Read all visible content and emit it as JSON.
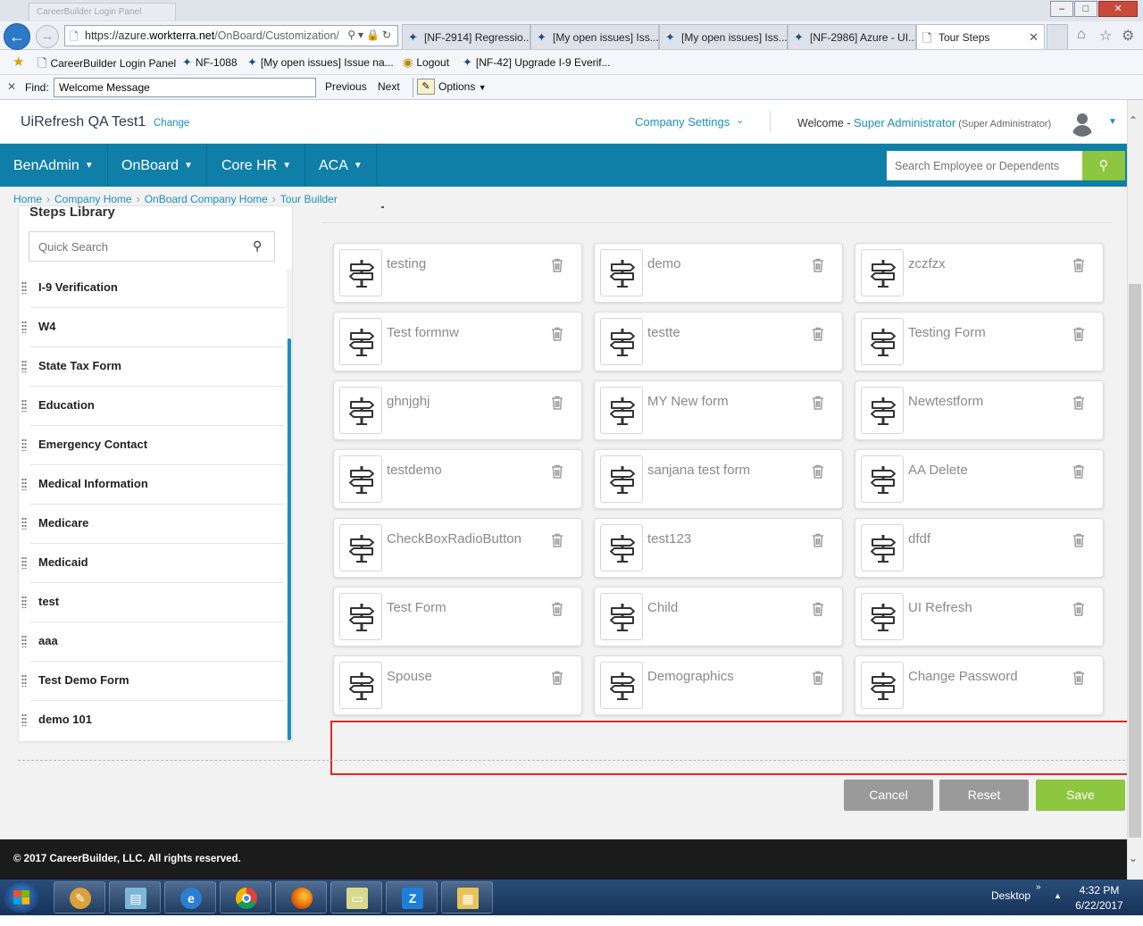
{
  "browser": {
    "ghost_tab": "CareerBuilder Login Panel",
    "url_prefix": "https://azure.",
    "url_domain": "workterra.net",
    "url_path": "/OnBoard/Customization/",
    "tabs": [
      {
        "label": "[NF-2914] Regressio..."
      },
      {
        "label": "[My open issues] Iss..."
      },
      {
        "label": "[My open issues] Iss..."
      },
      {
        "label": "[NF-2986] Azure - UI..."
      },
      {
        "label": "Tour Steps"
      }
    ],
    "favorites": [
      {
        "label": "CareerBuilder Login Panel"
      },
      {
        "label": "NF-1088"
      },
      {
        "label": "[My open issues] Issue na..."
      },
      {
        "label": "Logout"
      },
      {
        "label": "[NF-42] Upgrade I-9 Everif..."
      }
    ],
    "find": {
      "label": "Find:",
      "value": "Welcome Message",
      "previous": "Previous",
      "next": "Next",
      "options": "Options"
    }
  },
  "header": {
    "company": "UiRefresh QA Test1",
    "change": "Change",
    "company_settings": "Company Settings",
    "welcome_prefix": "Welcome - ",
    "user_name": "Super Administrator",
    "user_role": " (Super Administrator)"
  },
  "nav": {
    "menus": [
      {
        "label": "BenAdmin"
      },
      {
        "label": "OnBoard"
      },
      {
        "label": "Core HR"
      },
      {
        "label": "ACA"
      }
    ],
    "search_placeholder": "Search Employee or Dependents"
  },
  "breadcrumb": [
    "Home",
    "Company Home",
    "OnBoard Company Home",
    "Tour Builder"
  ],
  "library": {
    "title": "Steps Library",
    "search_placeholder": "Quick Search",
    "items": [
      "I-9 Verification",
      "W4",
      "State Tax Form",
      "Education",
      "Emergency Contact",
      "Medical Information",
      "Medicare",
      "Medicaid",
      "test",
      "aaa",
      "Test Demo Form",
      "demo 101"
    ]
  },
  "steps": [
    "testing",
    "demo",
    "zczfzx",
    "Test formnw",
    "testte",
    "Testing Form",
    "ghnjghj",
    "MY New form",
    "Newtestform",
    "testdemo",
    "sanjana test form",
    "AA Delete",
    "CheckBoxRadioButton",
    "test123",
    "dfdf",
    "Test Form",
    "Child",
    "UI Refresh",
    "Spouse",
    "Demographics",
    "Change Password"
  ],
  "actions": {
    "cancel": "Cancel",
    "reset": "Reset",
    "save": "Save"
  },
  "footer": {
    "copyright": "© 2017 CareerBuilder, LLC. All rights reserved."
  },
  "taskbar": {
    "desktop": "Desktop",
    "time": "4:32 PM",
    "date": "6/22/2017"
  },
  "colors": {
    "nav_bg": "#0f7fa7",
    "link": "#1c8fbe",
    "save": "#8dc63f",
    "neutral_button": "#9a9a9a",
    "highlight_box": "#e32626"
  }
}
